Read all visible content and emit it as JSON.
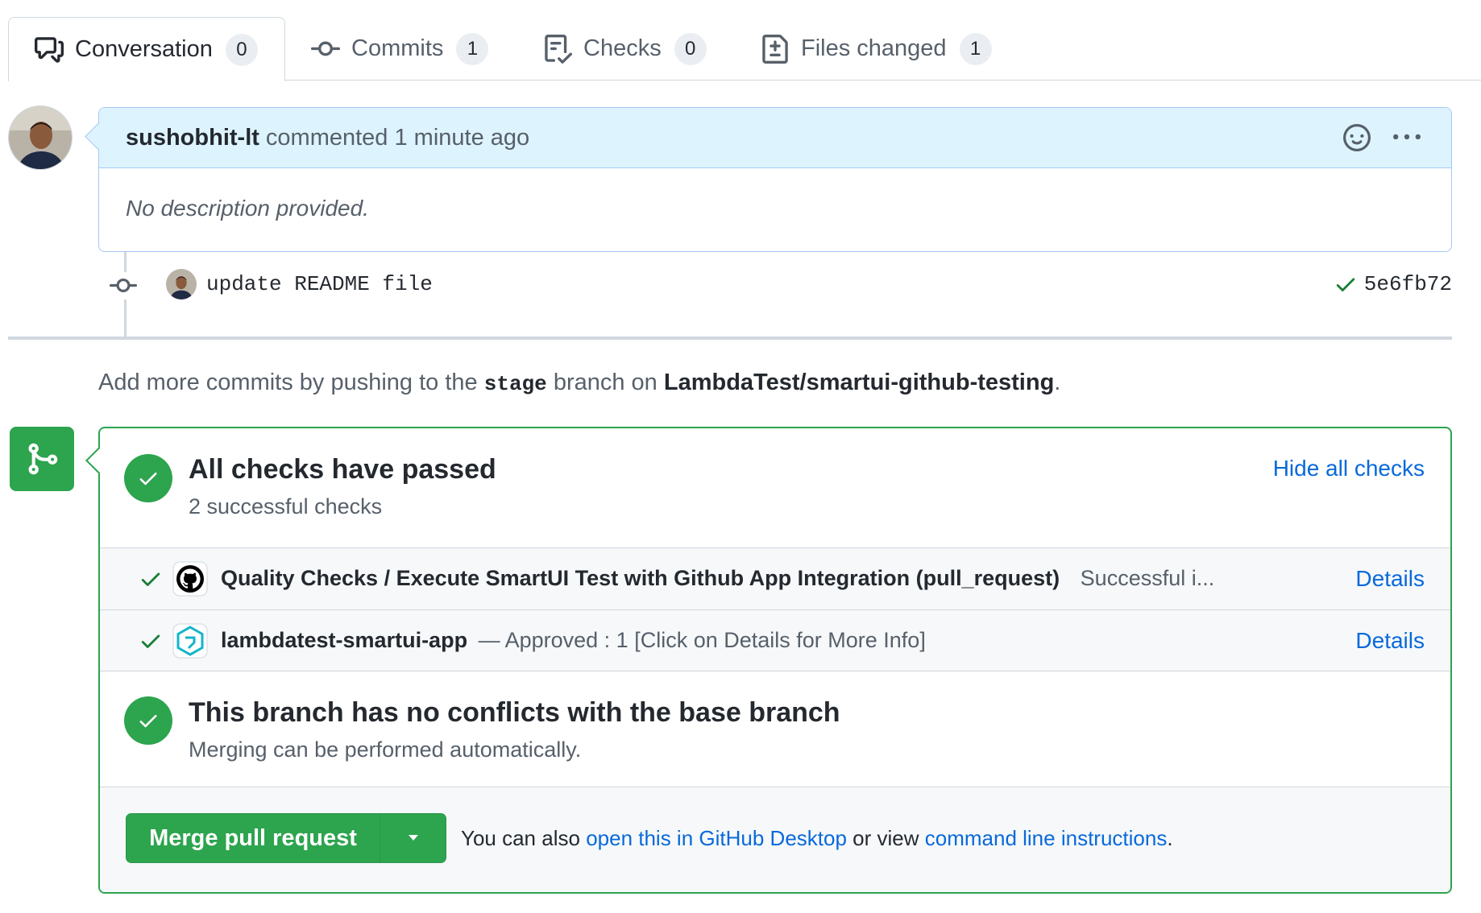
{
  "tabs": [
    {
      "label": "Conversation",
      "count": "0",
      "icon": "comment-discussion-icon",
      "selected": true
    },
    {
      "label": "Commits",
      "count": "1",
      "icon": "git-commit-icon"
    },
    {
      "label": "Checks",
      "count": "0",
      "icon": "checklist-icon"
    },
    {
      "label": "Files changed",
      "count": "1",
      "icon": "file-diff-icon"
    }
  ],
  "comment": {
    "author": "sushobhit-lt",
    "action": "commented 1 minute ago",
    "body": "No description provided."
  },
  "commit": {
    "message": "update README file",
    "sha": "5e6fb72"
  },
  "push_info": {
    "prefix": "Add more commits by pushing to the",
    "branch": "stage",
    "middle": "branch on",
    "repo": "LambdaTest/smartui-github-testing",
    "suffix": "."
  },
  "checks": {
    "title": "All checks have passed",
    "subtitle": "2 successful checks",
    "hide_label": "Hide all checks",
    "items": [
      {
        "name": "Quality Checks / Execute SmartUI Test with Github App Integration (pull_request)",
        "description": "Successful i...",
        "details": "Details"
      },
      {
        "name": "lambdatest-smartui-app",
        "description": "— Approved : 1 [Click on Details for More Info]",
        "details": "Details"
      }
    ]
  },
  "conflicts": {
    "title": "This branch has no conflicts with the base branch",
    "subtitle": "Merging can be performed automatically."
  },
  "merge": {
    "button_label": "Merge pull request",
    "hint_prefix": "You can also",
    "desktop_link": "open this in GitHub Desktop",
    "hint_middle": "or view",
    "cli_link": "command line instructions",
    "hint_suffix": "."
  },
  "colors": {
    "success": "#2da44e",
    "link": "#0969da",
    "comment_header": "#ddf4ff"
  }
}
